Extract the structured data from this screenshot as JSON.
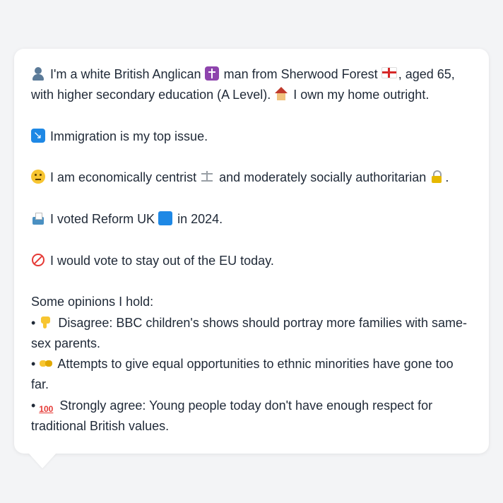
{
  "bubble": {
    "intro": {
      "part1": "I'm a white British Anglican",
      "part2": "man from Sherwood Forest",
      "part3": ", aged 65, with higher secondary education (A Level).",
      "part4": "I own my home outright.",
      "icons": [
        "person-icon",
        "latin-cross-icon",
        "england-flag-icon",
        "house-icon"
      ]
    },
    "immigration": {
      "text": "Immigration is my top issue.",
      "icon": "arrow-down-right-icon"
    },
    "economics": {
      "part1": "I am economically centrist",
      "part2": "and moderately socially authoritarian",
      "part3": ".",
      "icons": [
        "thinking-face-icon",
        "scales-icon",
        "lock-icon"
      ]
    },
    "vote": {
      "part1": "I voted Reform UK",
      "part2": "in 2024.",
      "icons": [
        "ballot-box-icon",
        "blue-square-icon"
      ]
    },
    "eu": {
      "text": "I would vote to stay out of the EU today.",
      "icon": "no-entry-icon"
    },
    "opinions_header": "Some opinions I hold:",
    "opinions": [
      {
        "bullet": "•",
        "icon": "thumbs-down-icon",
        "text": "Disagree: BBC children's shows should portray more families with same-sex parents."
      },
      {
        "bullet": "•",
        "icon": "handshake-icon",
        "text": "Attempts to give equal opportunities to ethnic minorities have gone too far."
      },
      {
        "bullet": "•",
        "icon": "hundred-points-icon",
        "text": "Strongly agree: Young people today don't have enough respect for traditional British values."
      }
    ]
  }
}
